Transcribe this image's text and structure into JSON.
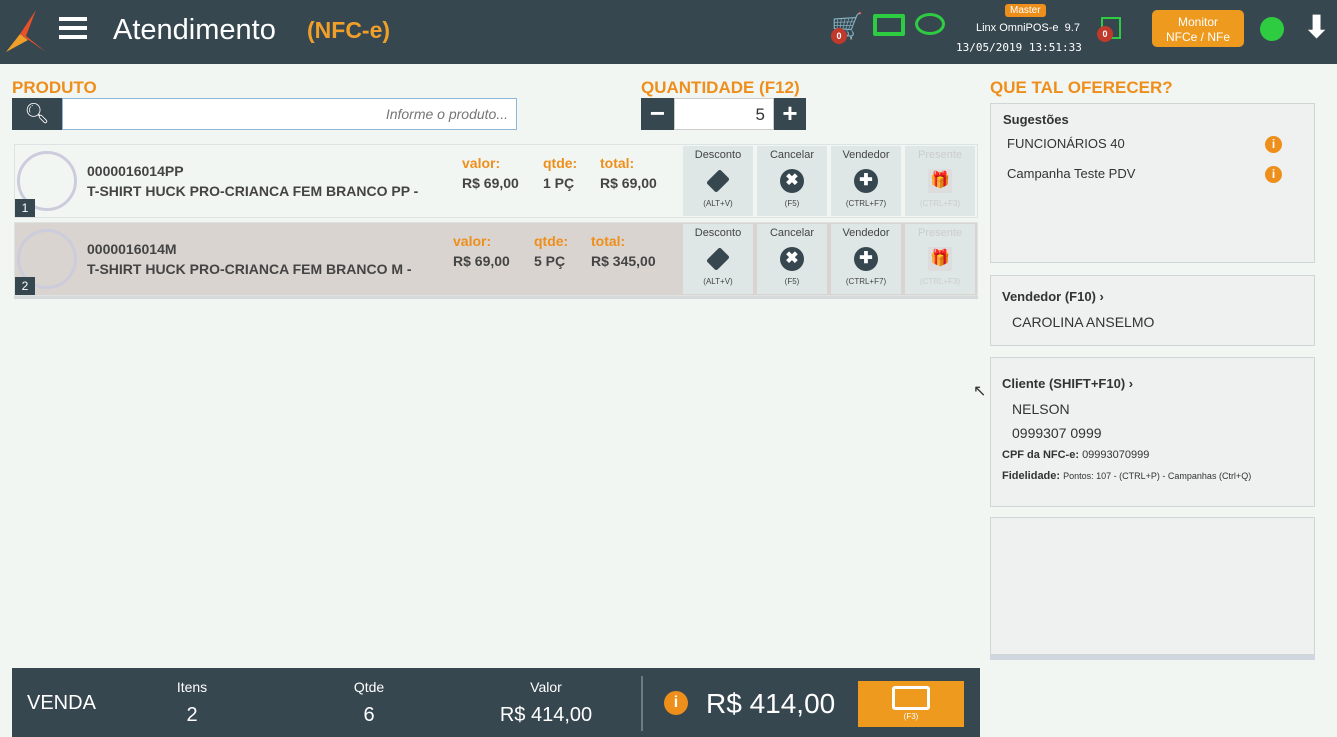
{
  "header": {
    "title": "Atendimento",
    "subtitle": "(NFC-e)",
    "cart_count": "0",
    "role_badge": "Master",
    "app_name": "Linx OmniPOS-e",
    "version": "9.7",
    "datetime": "13/05/2019 13:51:33",
    "docs_count": "0",
    "monitor_button": "Monitor\nNFCe / NFe",
    "monitor_line1": "Monitor",
    "monitor_line2": "NFCe / NFe"
  },
  "produto": {
    "label": "PRODUTO",
    "placeholder": "Informe o produto..."
  },
  "quantidade": {
    "label": "QUANTIDADE (F12)",
    "value": "5"
  },
  "items": [
    {
      "n": "1",
      "code": "0000016014PP",
      "desc": "T-SHIRT HUCK PRO-CRIANCA FEM BRANCO PP -",
      "valor_label": "valor:",
      "valor": "R$ 69,00",
      "qtde_label": "qtde:",
      "qtde": "1 PÇ",
      "total_label": "total:",
      "total": "R$ 69,00"
    },
    {
      "n": "2",
      "code": "0000016014M",
      "desc": "T-SHIRT HUCK PRO-CRIANCA FEM BRANCO M -",
      "valor_label": "valor:",
      "valor": "R$ 69,00",
      "qtde_label": "qtde:",
      "qtde": "5 PÇ",
      "total_label": "total:",
      "total": "R$ 345,00"
    }
  ],
  "actions": [
    {
      "label": "Desconto",
      "key": "(ALT+V)"
    },
    {
      "label": "Cancelar",
      "key": "(F5)"
    },
    {
      "label": "Vendedor",
      "key": "(CTRL+F7)"
    },
    {
      "label": "Presente",
      "key": "(CTRL+F3)"
    }
  ],
  "side": {
    "title": "QUE TAL OFERECER?",
    "sugestoes": "Sugestões",
    "sug_items": [
      "FUNCIONÁRIOS 40",
      "Campanha Teste PDV"
    ],
    "vendedor_label": "Vendedor (F10)",
    "vendedor": "CAROLINA ANSELMO",
    "cliente_label": "Cliente (SHIFT+F10)",
    "cliente": "NELSON",
    "cliente_doc": "0999307 0999",
    "cpf_label": "CPF da NFC-e:",
    "cpf": "09993070999",
    "fid_label": "Fidelidade:",
    "fid": "Pontos: 107 - (CTRL+P) - Campanhas (Ctrl+Q)"
  },
  "footer": {
    "venda": "VENDA",
    "itens_label": "Itens",
    "itens": "2",
    "qtde_label": "Qtde",
    "qtde": "6",
    "valor_label": "Valor",
    "valor": "R$ 414,00",
    "total": "R$ 414,00",
    "pay_key": "(F3)"
  }
}
